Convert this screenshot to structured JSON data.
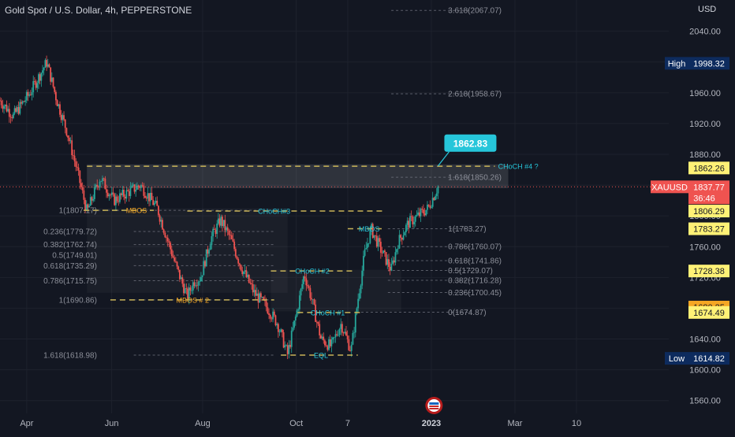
{
  "header": {
    "title": "Gold Spot / U.S. Dollar, 4h, PEPPERSTONE",
    "currency": "USD"
  },
  "chart_data": {
    "type": "candlestick",
    "symbol": "XAUUSD",
    "ylim": [
      1540,
      2100
    ],
    "price_ticks": [
      2040,
      2000,
      1960,
      1920,
      1880,
      1840,
      1800,
      1760,
      1720,
      1680,
      1640,
      1600,
      1560
    ],
    "price_tick_labels": [
      "2040.00",
      "2000.00",
      "1960.00",
      "1920.00",
      "1880.00",
      "1840.00",
      "1800.00",
      "1760.00",
      "1720.00",
      "1680.00",
      "1640.00",
      "1600.00",
      "1560.00"
    ],
    "time_labels": [
      "Apr",
      "Jun",
      "Aug",
      "Oct",
      "7",
      "2023",
      "Mar",
      "10"
    ],
    "time_label_index": [
      0.04,
      0.167,
      0.303,
      0.443,
      0.52,
      0.645,
      0.77,
      0.862
    ],
    "anchors": [
      [
        0.0,
        1950
      ],
      [
        0.02,
        1930
      ],
      [
        0.045,
        1960
      ],
      [
        0.07,
        2000
      ],
      [
        0.085,
        1950
      ],
      [
        0.1,
        1910
      ],
      [
        0.115,
        1860
      ],
      [
        0.13,
        1805
      ],
      [
        0.15,
        1850
      ],
      [
        0.17,
        1820
      ],
      [
        0.19,
        1830
      ],
      [
        0.21,
        1840
      ],
      [
        0.235,
        1810
      ],
      [
        0.25,
        1770
      ],
      [
        0.265,
        1730
      ],
      [
        0.28,
        1695
      ],
      [
        0.29,
        1715
      ],
      [
        0.3,
        1720
      ],
      [
        0.315,
        1770
      ],
      [
        0.33,
        1795
      ],
      [
        0.345,
        1770
      ],
      [
        0.36,
        1735
      ],
      [
        0.38,
        1700
      ],
      [
        0.4,
        1680
      ],
      [
        0.415,
        1660
      ],
      [
        0.43,
        1620
      ],
      [
        0.445,
        1680
      ],
      [
        0.455,
        1725
      ],
      [
        0.465,
        1695
      ],
      [
        0.48,
        1640
      ],
      [
        0.495,
        1630
      ],
      [
        0.51,
        1660
      ],
      [
        0.525,
        1625
      ],
      [
        0.535,
        1690
      ],
      [
        0.545,
        1750
      ],
      [
        0.555,
        1783
      ],
      [
        0.57,
        1755
      ],
      [
        0.585,
        1730
      ],
      [
        0.595,
        1765
      ],
      [
        0.61,
        1790
      ],
      [
        0.625,
        1800
      ],
      [
        0.64,
        1810
      ],
      [
        0.655,
        1838
      ]
    ],
    "last_price": 1837.77,
    "last_price_label": "1837.77",
    "countdown": "36:46",
    "high": {
      "label": "High",
      "value": "1998.32",
      "price": 1998.32
    },
    "low": {
      "label": "Low",
      "value": "1614.82",
      "price": 1614.82
    },
    "hidden_price_tag": {
      "value": "1680.25",
      "price": 1681.5
    },
    "callout": {
      "value": "1862.83",
      "price": 1862.83
    },
    "price_tags": [
      {
        "value": "1862.26",
        "price": 1862.26
      },
      {
        "value": "1806.29",
        "price": 1806.29
      },
      {
        "value": "1783.27",
        "price": 1783.27
      },
      {
        "value": "1728.38",
        "price": 1728.38
      },
      {
        "value": "1674.49",
        "price": 1674.49
      }
    ],
    "fib_labels": [
      {
        "text": "3.618(2067.07)",
        "price": 2067.07,
        "x0": 0.585,
        "x1": 0.705,
        "lx": 0.67
      },
      {
        "text": "2.618(1958.67)",
        "price": 1958.67,
        "x0": 0.585,
        "x1": 0.705,
        "lx": 0.67
      },
      {
        "text": "1.618(1850.26)",
        "price": 1850.26,
        "x0": 0.585,
        "x1": 0.705,
        "lx": 0.67
      },
      {
        "text": "1(1783.27)",
        "price": 1783.27,
        "x0": 0.58,
        "x1": 0.705,
        "lx": 0.67
      },
      {
        "text": "0.786(1760.07)",
        "price": 1760.07,
        "x0": 0.58,
        "x1": 0.705,
        "lx": 0.67
      },
      {
        "text": "0.618(1741.86)",
        "price": 1741.86,
        "x0": 0.58,
        "x1": 0.705,
        "lx": 0.67
      },
      {
        "text": "0.5(1729.07)",
        "price": 1729.07,
        "x0": 0.58,
        "x1": 0.705,
        "lx": 0.67
      },
      {
        "text": "0.382(1716.28)",
        "price": 1716.28,
        "x0": 0.58,
        "x1": 0.705,
        "lx": 0.67
      },
      {
        "text": "0.236(1700.45)",
        "price": 1700.45,
        "x0": 0.58,
        "x1": 0.705,
        "lx": 0.67
      },
      {
        "text": "0(1674.87)",
        "price": 1674.87,
        "x0": 0.54,
        "x1": 0.705,
        "lx": 0.67
      },
      {
        "text": "1(1807.17)",
        "price": 1807.17,
        "x0": 0.125,
        "x1": 0.41,
        "lx": 0.145
      },
      {
        "text": "0.236(1779.72)",
        "price": 1779.72,
        "x0": 0.2,
        "x1": 0.41,
        "lx": 0.145
      },
      {
        "text": "0.382(1762.74)",
        "price": 1762.74,
        "x0": 0.2,
        "x1": 0.41,
        "lx": 0.145
      },
      {
        "text": "0.5(1749.01)",
        "price": 1749.01,
        "x0": 0.2,
        "x1": 0.41,
        "lx": 0.145
      },
      {
        "text": "0.618(1735.29)",
        "price": 1735.29,
        "x0": 0.2,
        "x1": 0.41,
        "lx": 0.145
      },
      {
        "text": "0.786(1715.75)",
        "price": 1715.75,
        "x0": 0.2,
        "x1": 0.41,
        "lx": 0.145
      },
      {
        "text": "1(1690.86)",
        "price": 1690.86,
        "x0": 0.2,
        "x1": 0.41,
        "lx": 0.145
      },
      {
        "text": "1.618(1618.98)",
        "price": 1618.98,
        "x0": 0.2,
        "x1": 0.41,
        "lx": 0.145
      }
    ],
    "structure_lines": [
      {
        "label": "CHoCH #4 ?",
        "price": 1864.5,
        "x0": 0.13,
        "x1": 0.74,
        "lx": 0.775,
        "color": "#26c6da"
      },
      {
        "label": "CHoCH#3",
        "price": 1806.29,
        "x0": 0.28,
        "x1": 0.575,
        "lx": 0.41,
        "color": "#26c6da"
      },
      {
        "label": "MBOS",
        "price": 1807.17,
        "x0": 0.125,
        "x1": 0.23,
        "lx": 0.204,
        "color": "#f5a623"
      },
      {
        "label": "MBOS",
        "price": 1783.27,
        "x0": 0.52,
        "x1": 0.575,
        "lx": 0.552,
        "color": "#26c6da"
      },
      {
        "label": "CHoCH #2",
        "price": 1728.38,
        "x0": 0.405,
        "x1": 0.53,
        "lx": 0.467,
        "color": "#26c6da"
      },
      {
        "label": "MBOS # 2",
        "price": 1690.86,
        "x0": 0.165,
        "x1": 0.41,
        "lx": 0.288,
        "color": "#f5a623"
      },
      {
        "label": "CHoCH #1",
        "price": 1674.49,
        "x0": 0.445,
        "x1": 0.54,
        "lx": 0.49,
        "color": "#26c6da"
      },
      {
        "label": "EQL",
        "price": 1618.98,
        "x0": 0.42,
        "x1": 0.535,
        "lx": 0.48,
        "color": "#26c6da"
      }
    ],
    "zones": [
      {
        "p1": 1867,
        "p2": 1836,
        "x0": 0.13,
        "x1": 0.76
      },
      {
        "p1": 1810,
        "p2": 1700,
        "x0": 0.13,
        "x1": 0.43
      },
      {
        "p1": 1730,
        "p2": 1676,
        "x0": 0.405,
        "x1": 0.6
      }
    ]
  }
}
